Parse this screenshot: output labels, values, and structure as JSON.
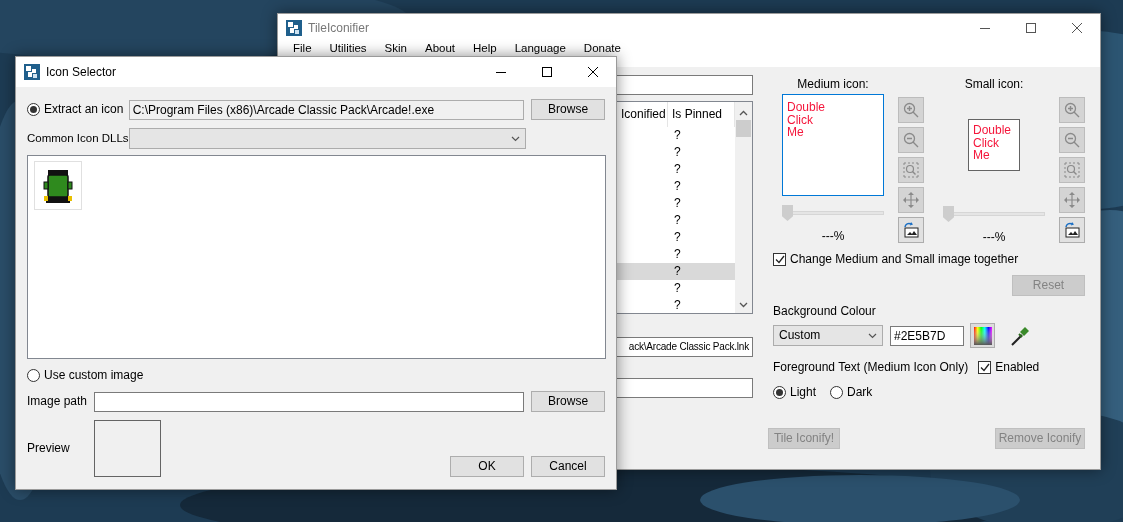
{
  "main_window": {
    "title": "TileIconifier",
    "menu": [
      "File",
      "Utilities",
      "Skin",
      "About",
      "Help",
      "Language",
      "Donate"
    ],
    "shortcut_list": {
      "columns": [
        "Iconified",
        "Is Pinned"
      ],
      "rows": [
        {
          "is_pinned": "?",
          "selected": false
        },
        {
          "is_pinned": "?",
          "selected": false
        },
        {
          "is_pinned": "?",
          "selected": false
        },
        {
          "is_pinned": "?",
          "selected": false
        },
        {
          "is_pinned": "?",
          "selected": false
        },
        {
          "is_pinned": "?",
          "selected": false
        },
        {
          "is_pinned": "?",
          "selected": false
        },
        {
          "is_pinned": "?",
          "selected": false
        },
        {
          "is_pinned": "?",
          "selected": true
        },
        {
          "is_pinned": "?",
          "selected": false
        },
        {
          "is_pinned": "?",
          "selected": false
        }
      ]
    },
    "shortcut_path": "ack\\Arcade Classic Pack.lnk",
    "icons": [
      {
        "label": "Medium icon:",
        "preview_text": "Double Click Me",
        "focused": true,
        "level": 0,
        "reading": "---%",
        "tools": [
          {
            "kind": "zoom_in",
            "disabled": true
          },
          {
            "kind": "zoom_out",
            "disabled": true
          },
          {
            "kind": "fit",
            "disabled": true
          },
          {
            "kind": "move",
            "disabled": true
          },
          {
            "kind": "replace",
            "disabled": false
          }
        ]
      },
      {
        "label": "Small icon:",
        "preview_text": "Double Click Me",
        "focused": false,
        "level": 0,
        "reading": "---%",
        "tools": [
          {
            "kind": "zoom_in",
            "disabled": true
          },
          {
            "kind": "zoom_out",
            "disabled": true
          },
          {
            "kind": "fit",
            "disabled": true
          },
          {
            "kind": "move",
            "disabled": true
          },
          {
            "kind": "replace",
            "disabled": false
          }
        ]
      }
    ],
    "change_together": {
      "label": "Change Medium and Small image together",
      "checked": true
    },
    "reset_button": {
      "label": "Reset",
      "disabled": true
    },
    "background_colour": {
      "label": "Background Colour",
      "mode": "Custom",
      "hex": "#2E5B7D"
    },
    "foreground_text": {
      "label": "Foreground Text (Medium Icon Only)",
      "enabled": {
        "label": "Enabled",
        "checked": true
      },
      "options": [
        {
          "label": "Light",
          "selected": true
        },
        {
          "label": "Dark",
          "selected": false
        }
      ]
    },
    "buttons": [
      {
        "label": "Tile Iconify!",
        "disabled": true
      },
      {
        "label": "Remove Iconify",
        "disabled": true
      }
    ]
  },
  "icon_selector": {
    "title": "Icon Selector",
    "extract": {
      "label": "Extract an icon",
      "selected": true,
      "path": "C:\\Program Files (x86)\\Arcade Classic Pack\\Arcade!.exe",
      "browse": "Browse"
    },
    "dll": {
      "label": "Common Icon DLLs",
      "disabled": true
    },
    "custom": {
      "label": "Use custom image",
      "selected": false
    },
    "image_path": {
      "label": "Image path",
      "browse": "Browse"
    },
    "preview": {
      "label": "Preview"
    },
    "buttons": [
      "OK",
      "Cancel"
    ]
  }
}
